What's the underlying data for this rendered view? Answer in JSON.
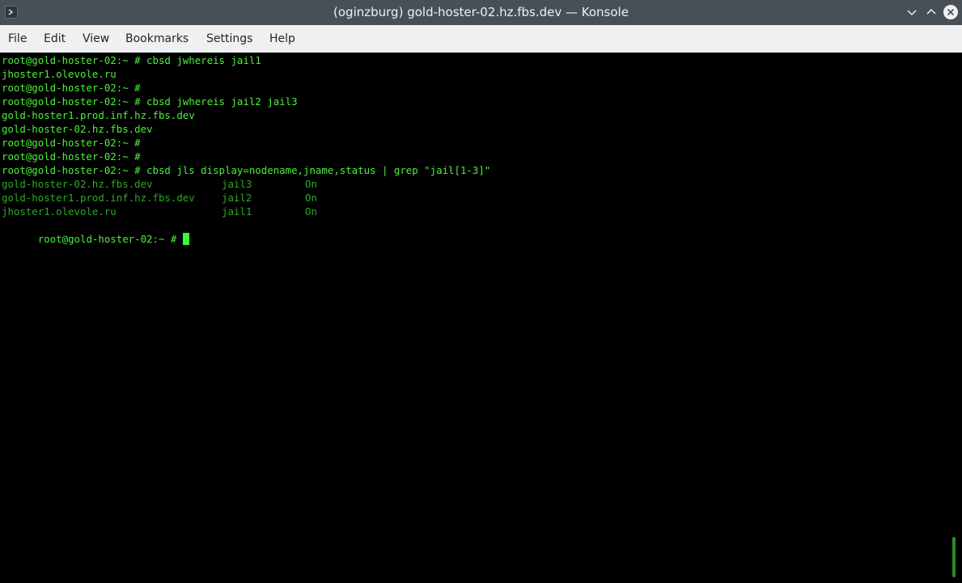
{
  "window": {
    "title": "(oginzburg) gold-hoster-02.hz.fbs.dev — Konsole",
    "app_icon": "terminal-icon",
    "controls": [
      "minimize-chevron-icon",
      "maximize-chevron-icon",
      "close-icon"
    ]
  },
  "menu": {
    "file": "File",
    "edit": "Edit",
    "view": "View",
    "bookmarks": "Bookmarks",
    "settings": "Settings",
    "help": "Help"
  },
  "terminal": {
    "lines": [
      "root@gold-hoster-02:~ # cbsd jwhereis jail1",
      "jhoster1.olevole.ru",
      "root@gold-hoster-02:~ #",
      "root@gold-hoster-02:~ # cbsd jwhereis jail2 jail3",
      "gold-hoster1.prod.inf.hz.fbs.dev",
      "gold-hoster-02.hz.fbs.dev",
      "root@gold-hoster-02:~ #",
      "root@gold-hoster-02:~ #",
      "root@gold-hoster-02:~ # cbsd jls display=nodename,jname,status | grep \"jail[1-3]\""
    ],
    "table_rows": [
      {
        "nodename": "gold-hoster-02.hz.fbs.dev",
        "jname": "jail3",
        "status": "On"
      },
      {
        "nodename": "gold-hoster1.prod.inf.hz.fbs.dev",
        "jname": "jail2",
        "status": "On"
      },
      {
        "nodename": "jhoster1.olevole.ru",
        "jname": "jail1",
        "status": "On"
      }
    ],
    "prompt": "root@gold-hoster-02:~ # "
  },
  "colors": {
    "text": "#4cf03a",
    "dim_text": "#2fa826",
    "background": "#000000",
    "titlebar": "#475057",
    "menubar": "#eff0f1"
  }
}
